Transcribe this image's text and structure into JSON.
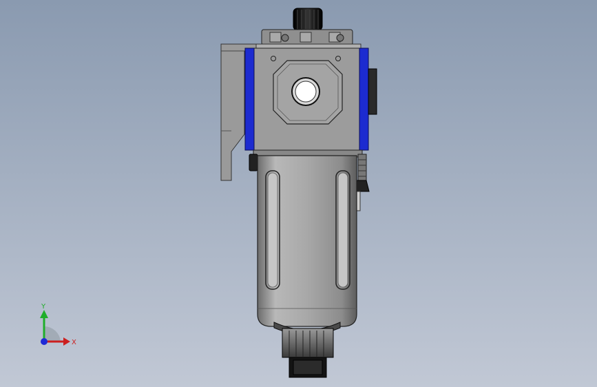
{
  "viewport": {
    "background_top": "#8a9ab0",
    "background_bottom": "#c1c8d5"
  },
  "model": {
    "body_color": "#9c9c9c",
    "port_flange_color": "#1c2bd0",
    "bowl_color": "#a0a0a0",
    "knob_color": "#111111"
  },
  "triad": {
    "x_label": "X",
    "y_label": "Y",
    "x_color": "#cc1f1f",
    "y_color": "#1fae2a",
    "z_color": "#1f2ad6"
  }
}
